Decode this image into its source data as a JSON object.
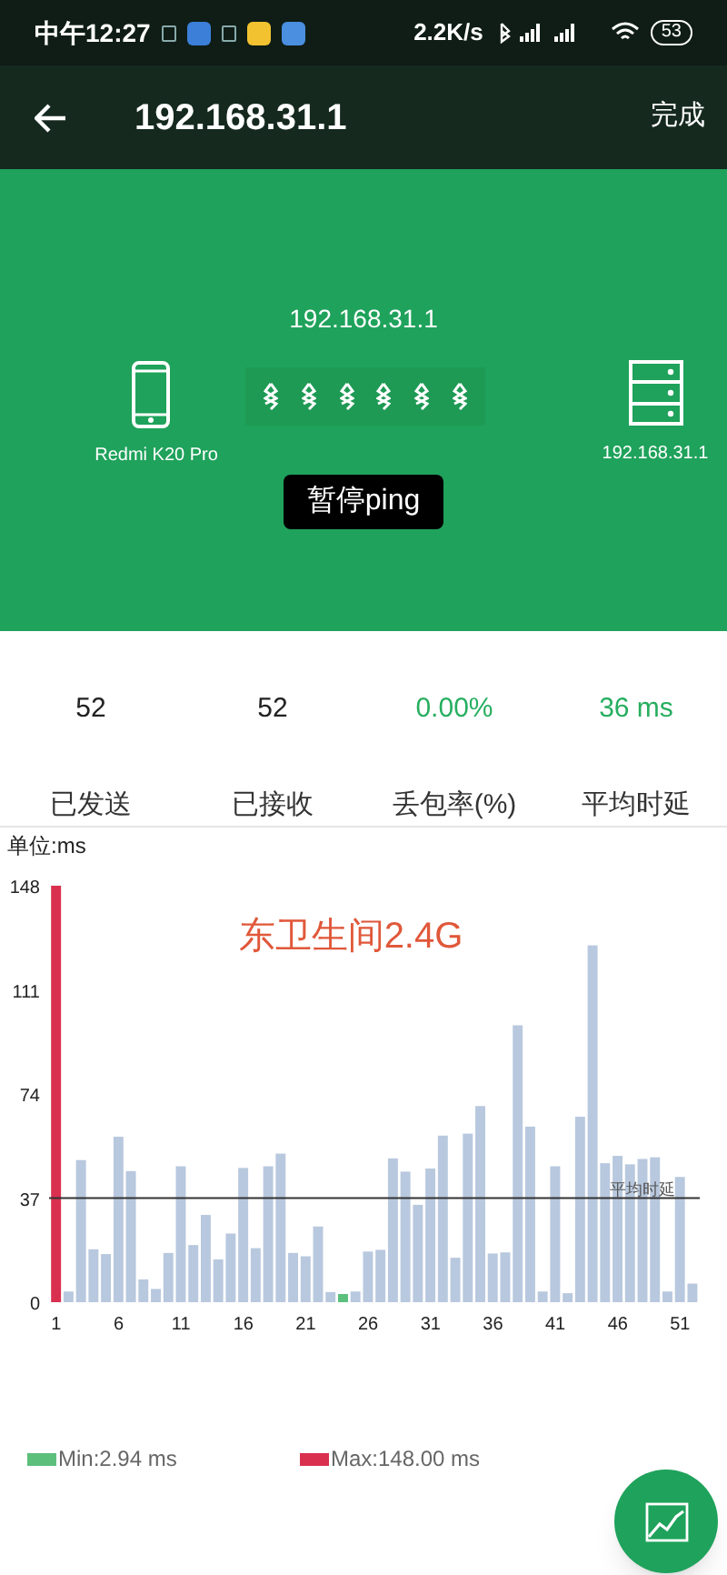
{
  "status_bar": {
    "time": "中午12:27",
    "speed": "2.2K/s",
    "battery": "53"
  },
  "app_bar": {
    "title": "192.168.31.1",
    "action": "完成"
  },
  "connection": {
    "target": "192.168.31.1",
    "device": "Redmi K20 Pro",
    "host": "192.168.31.1",
    "button": "暂停ping"
  },
  "stats": [
    {
      "value": "52",
      "label": "已发送",
      "highlight": false
    },
    {
      "value": "52",
      "label": "已接收",
      "highlight": false
    },
    {
      "value": "0.00%",
      "label": "丢包率(%)",
      "highlight": true
    },
    {
      "value": "36 ms",
      "label": "平均时延",
      "highlight": true
    }
  ],
  "unit": "单位:ms",
  "chart_data": {
    "type": "bar",
    "title": "东卫生间2.4G",
    "x": [
      1,
      2,
      3,
      4,
      5,
      6,
      7,
      8,
      9,
      10,
      11,
      12,
      13,
      14,
      15,
      16,
      17,
      18,
      19,
      20,
      21,
      22,
      23,
      24,
      25,
      26,
      27,
      28,
      29,
      30,
      31,
      32,
      33,
      34,
      35,
      36,
      37,
      38,
      39,
      40,
      41,
      42,
      43,
      44,
      45,
      46,
      47,
      48,
      49,
      50,
      51,
      52
    ],
    "series": [
      {
        "color": "#b8c8de",
        "values": [
          null,
          3.8,
          50.5,
          18.8,
          17.1,
          58.8,
          46.6,
          8.1,
          4.7,
          17.5,
          48.3,
          20.3,
          31,
          15.2,
          24.4,
          47.7,
          19.2,
          48.3,
          52.8,
          17.5,
          16.3,
          26.9,
          3.6,
          null,
          3.8,
          18,
          18.6,
          51.1,
          46.4,
          34.6,
          47.5,
          59.2,
          15.8,
          59.9,
          69.7,
          17.3,
          17.7,
          98.4,
          62.4,
          3.8,
          48.3,
          3.2,
          65.9,
          126.8,
          49.4,
          52,
          49,
          50.9,
          51.5,
          3.8,
          44.5,
          6.6
        ]
      },
      {
        "name": "Max:148.00 ms",
        "color": "#d9304f",
        "values": [
          148,
          null,
          null,
          null,
          null,
          null,
          null,
          null,
          null,
          null,
          null,
          null,
          null,
          null,
          null,
          null,
          null,
          null,
          null,
          null,
          null,
          null,
          null,
          null,
          null,
          null,
          null,
          null,
          null,
          null,
          null,
          null,
          null,
          null,
          null,
          null,
          null,
          null,
          null,
          null,
          null,
          null,
          null,
          null,
          null,
          null,
          null,
          null,
          null,
          null,
          null,
          null
        ]
      },
      {
        "name": "Min:2.94 ms",
        "color": "#5cbf7c",
        "values": [
          null,
          null,
          null,
          null,
          null,
          null,
          null,
          null,
          null,
          null,
          null,
          null,
          null,
          null,
          null,
          null,
          null,
          null,
          null,
          null,
          null,
          null,
          null,
          2.9,
          null,
          null,
          null,
          null,
          null,
          null,
          null,
          null,
          null,
          null,
          null,
          null,
          null,
          null,
          null,
          null,
          null,
          null,
          null,
          null,
          null,
          null,
          null,
          null,
          null,
          null,
          null,
          null
        ]
      }
    ],
    "xlim": [
      0.5,
      52.5
    ],
    "ylim": [
      0,
      148
    ],
    "yticks": [
      0,
      37,
      74,
      111,
      148
    ],
    "xticks": [
      1,
      6,
      11,
      16,
      21,
      26,
      31,
      36,
      41,
      46,
      51
    ],
    "annotations": [
      {
        "text": "平均时延",
        "x": 48,
        "y": 37
      }
    ]
  }
}
